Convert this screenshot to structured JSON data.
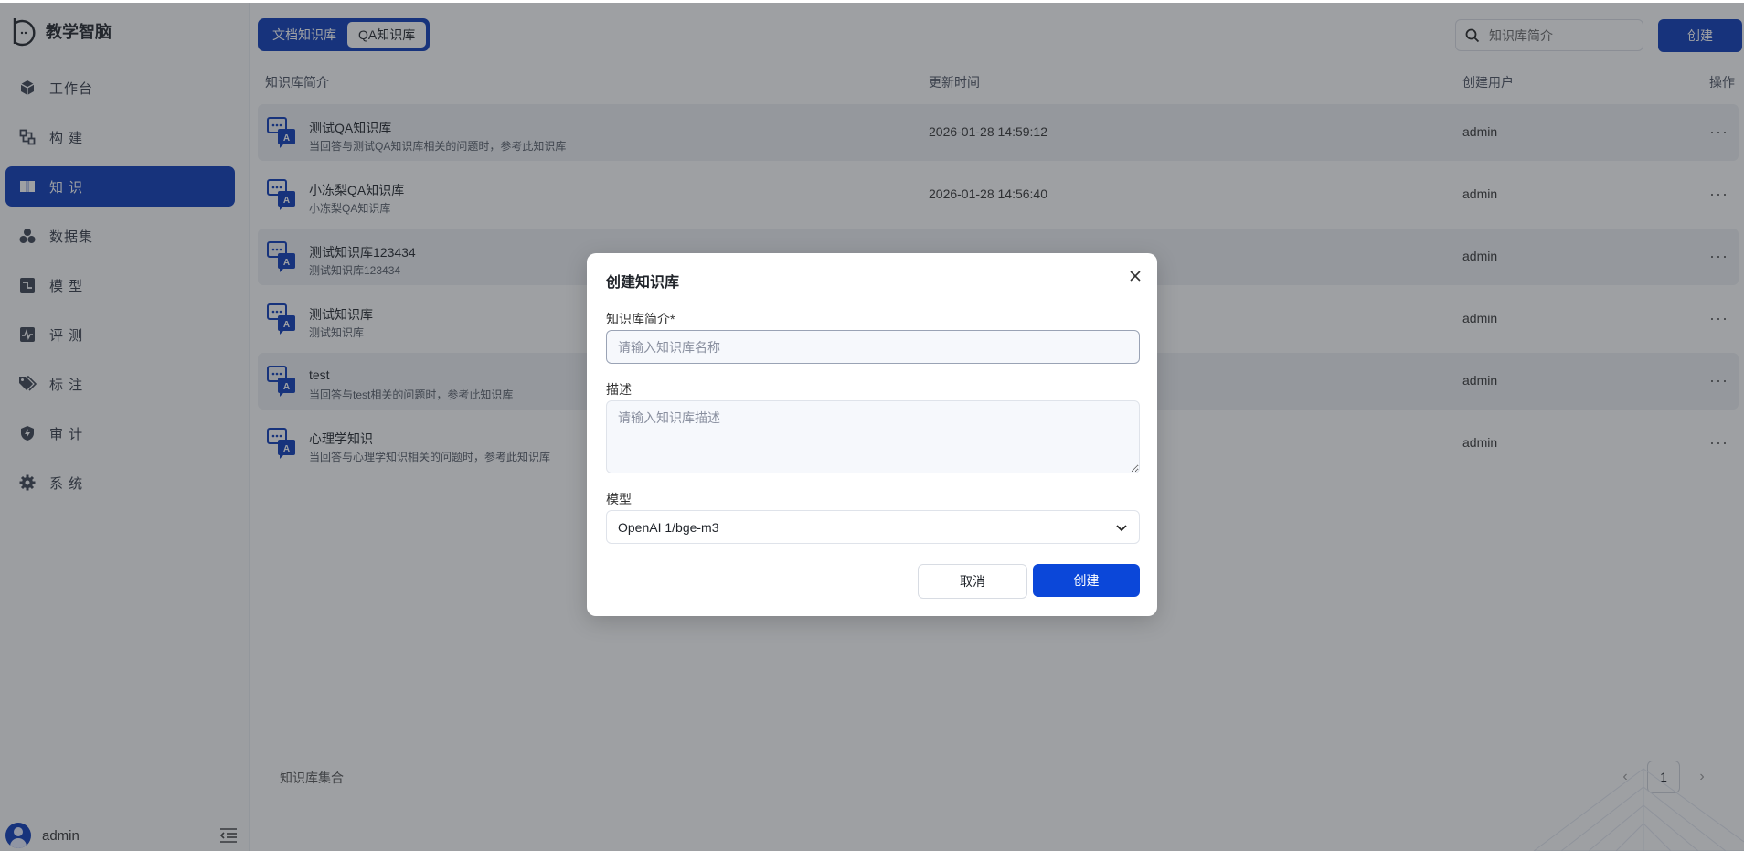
{
  "app": {
    "name": "教学智脑"
  },
  "sidebar": {
    "items": [
      {
        "label": "工作台",
        "icon": "cube-icon",
        "active": false
      },
      {
        "label": "构 建",
        "icon": "build-icon",
        "active": false
      },
      {
        "label": "知 识",
        "icon": "book-icon",
        "active": true
      },
      {
        "label": "数据集",
        "icon": "dataset-icon",
        "active": false
      },
      {
        "label": "模 型",
        "icon": "model-icon",
        "active": false
      },
      {
        "label": "评 测",
        "icon": "pulse-icon",
        "active": false
      },
      {
        "label": "标 注",
        "icon": "tag-icon",
        "active": false
      },
      {
        "label": "审 计",
        "icon": "shield-icon",
        "active": false
      },
      {
        "label": "系 统",
        "icon": "gear-icon",
        "active": false
      }
    ],
    "user": "admin"
  },
  "header": {
    "tabs": [
      {
        "label": "文档知识库"
      },
      {
        "label": "QA知识库"
      }
    ],
    "search_placeholder": "知识库简介",
    "create_label": "创建"
  },
  "table": {
    "columns": {
      "intro": "知识库简介",
      "updated": "更新时间",
      "creator": "创建用户",
      "actions": "操作"
    },
    "rows": [
      {
        "name": "测试QA知识库",
        "desc": "当回答与测试QA知识库相关的问题时，参考此知识库",
        "time": "2026-01-28 14:59:12",
        "user": "admin"
      },
      {
        "name": "小冻梨QA知识库",
        "desc": "小冻梨QA知识库",
        "time": "2026-01-28 14:56:40",
        "user": "admin"
      },
      {
        "name": "测试知识库123434",
        "desc": "测试知识库123434",
        "time": "",
        "user": "admin"
      },
      {
        "name": "测试知识库",
        "desc": "测试知识库",
        "time": "",
        "user": "admin"
      },
      {
        "name": "test",
        "desc": "当回答与test相关的问题时，参考此知识库",
        "time": "",
        "user": "admin"
      },
      {
        "name": "心理学知识",
        "desc": "当回答与心理学知识相关的问题时，参考此知识库",
        "time": "",
        "user": "admin"
      }
    ],
    "more_label": "···"
  },
  "footer": {
    "label": "知识库集合",
    "page": "1",
    "prev": "‹",
    "next": "›"
  },
  "modal": {
    "title": "创建知识库",
    "name_label": "知识库简介*",
    "name_placeholder": "请输入知识库名称",
    "desc_label": "描述",
    "desc_placeholder": "请输入知识库描述",
    "model_label": "模型",
    "model_value": "OpenAI 1/bge-m3",
    "cancel_label": "取消",
    "create_label": "创建"
  },
  "colors": {
    "primary": "#0a3ab8",
    "modal_button": "#0b47d9"
  }
}
